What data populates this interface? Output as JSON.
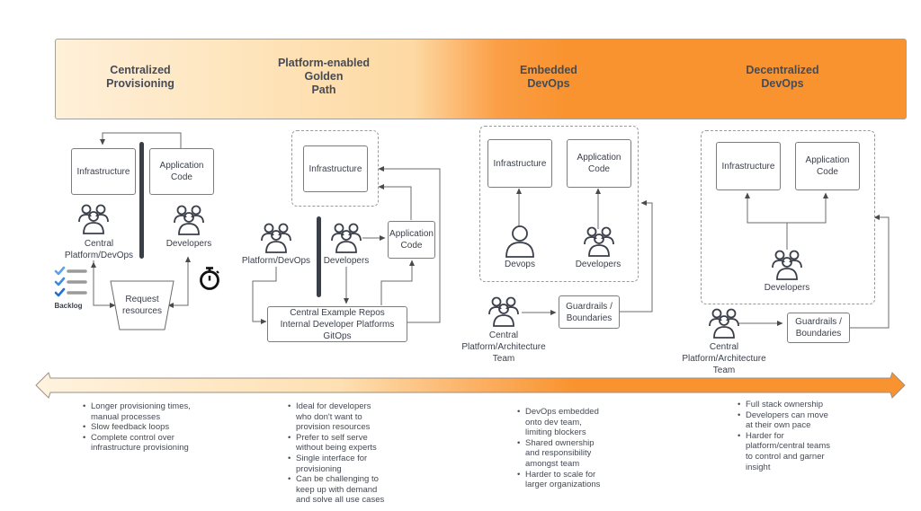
{
  "header": {
    "phases": [
      {
        "title": "Centralized\nProvisioning"
      },
      {
        "title": "Platform-enabled\nGolden\nPath"
      },
      {
        "title": "Embedded\nDevOps"
      },
      {
        "title": "Decentralized\nDevOps"
      }
    ]
  },
  "colors": {
    "band_light": "#fff0d9",
    "band_accent": "#f9932f",
    "divider": "#3b3f47",
    "check_blue": "#2f7fe0",
    "text": "#3a3f4a"
  },
  "centralized": {
    "infrastructure": "Infrastructure",
    "application_code": "Application\nCode",
    "team_label": "Central\nPlatform/DevOps",
    "developers_label": "Developers",
    "request_box": "Request\nresources",
    "backlog_label": "Backlog",
    "icons": [
      "group-icon",
      "group-icon",
      "checklist-icon",
      "stopwatch-icon"
    ]
  },
  "golden_path": {
    "infrastructure": "Infrastructure",
    "application_code": "Application\nCode",
    "team_label": "Platform/DevOps",
    "developers_label": "Developers",
    "platform_box": "Central Example Repos\nInternal Developer Platforms\nGitOps"
  },
  "embedded": {
    "infrastructure": "Infrastructure",
    "application_code": "Application\nCode",
    "devops_label": "Devops",
    "developers_label": "Developers",
    "guardrails": "Guardrails /\nBoundaries",
    "team_label": "Central\nPlatform/Architecture\nTeam"
  },
  "decentralized": {
    "infrastructure": "Infrastructure",
    "application_code": "Application\nCode",
    "developers_label": "Developers",
    "guardrails": "Guardrails /\nBoundaries",
    "team_label": "Central\nPlatform/Architecture\nTeam"
  },
  "notes": {
    "centralized": [
      "Longer provisioning times, manual processes",
      "Slow feedback loops",
      "Complete control over infrastructure provisioning"
    ],
    "golden_path": [
      "Ideal for developers who don't want to provision resources",
      "Prefer to self serve without being experts",
      "Single interface for provisioning",
      "Can be challenging to keep up with demand and solve all use cases"
    ],
    "embedded": [
      "DevOps embedded onto dev team, limiting blockers",
      "Shared ownership and responsibility amongst team",
      "Harder to scale for larger organizations"
    ],
    "decentralized": [
      "Full stack ownership",
      "Developers can move at their own pace",
      "Harder for platform/central teams to control and garner insight"
    ]
  }
}
